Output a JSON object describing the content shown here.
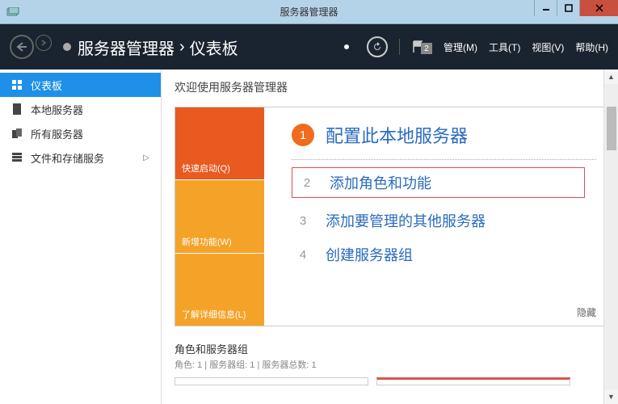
{
  "window": {
    "title": "服务器管理器"
  },
  "header": {
    "app": "服务器管理器",
    "section": "仪表板",
    "badge": "2",
    "menu": {
      "manage": "管理(M)",
      "tools": "工具(T)",
      "view": "视图(V)",
      "help": "帮助(H)"
    }
  },
  "sidebar": {
    "items": [
      {
        "label": "仪表板",
        "icon": "dashboard"
      },
      {
        "label": "本地服务器",
        "icon": "server"
      },
      {
        "label": "所有服务器",
        "icon": "servers"
      },
      {
        "label": "文件和存储服务",
        "icon": "storage",
        "has_submenu": true
      }
    ]
  },
  "main": {
    "welcome_heading": "欢迎使用服务器管理器",
    "tiles": [
      {
        "label": "快速启动(Q)",
        "color": "orange"
      },
      {
        "label": "新增功能(W)",
        "color": "amber1"
      },
      {
        "label": "了解详细信息(L)",
        "color": "amber2"
      }
    ],
    "steps": [
      {
        "num": "1",
        "text": "配置此本地服务器",
        "primary": true
      },
      {
        "num": "2",
        "text": "添加角色和功能",
        "boxed": true
      },
      {
        "num": "3",
        "text": "添加要管理的其他服务器"
      },
      {
        "num": "4",
        "text": "创建服务器组"
      }
    ],
    "hide": "隐藏",
    "roles": {
      "title": "角色和服务器组",
      "subtitle": "角色: 1 | 服务器组: 1 | 服务器总数: 1"
    }
  }
}
